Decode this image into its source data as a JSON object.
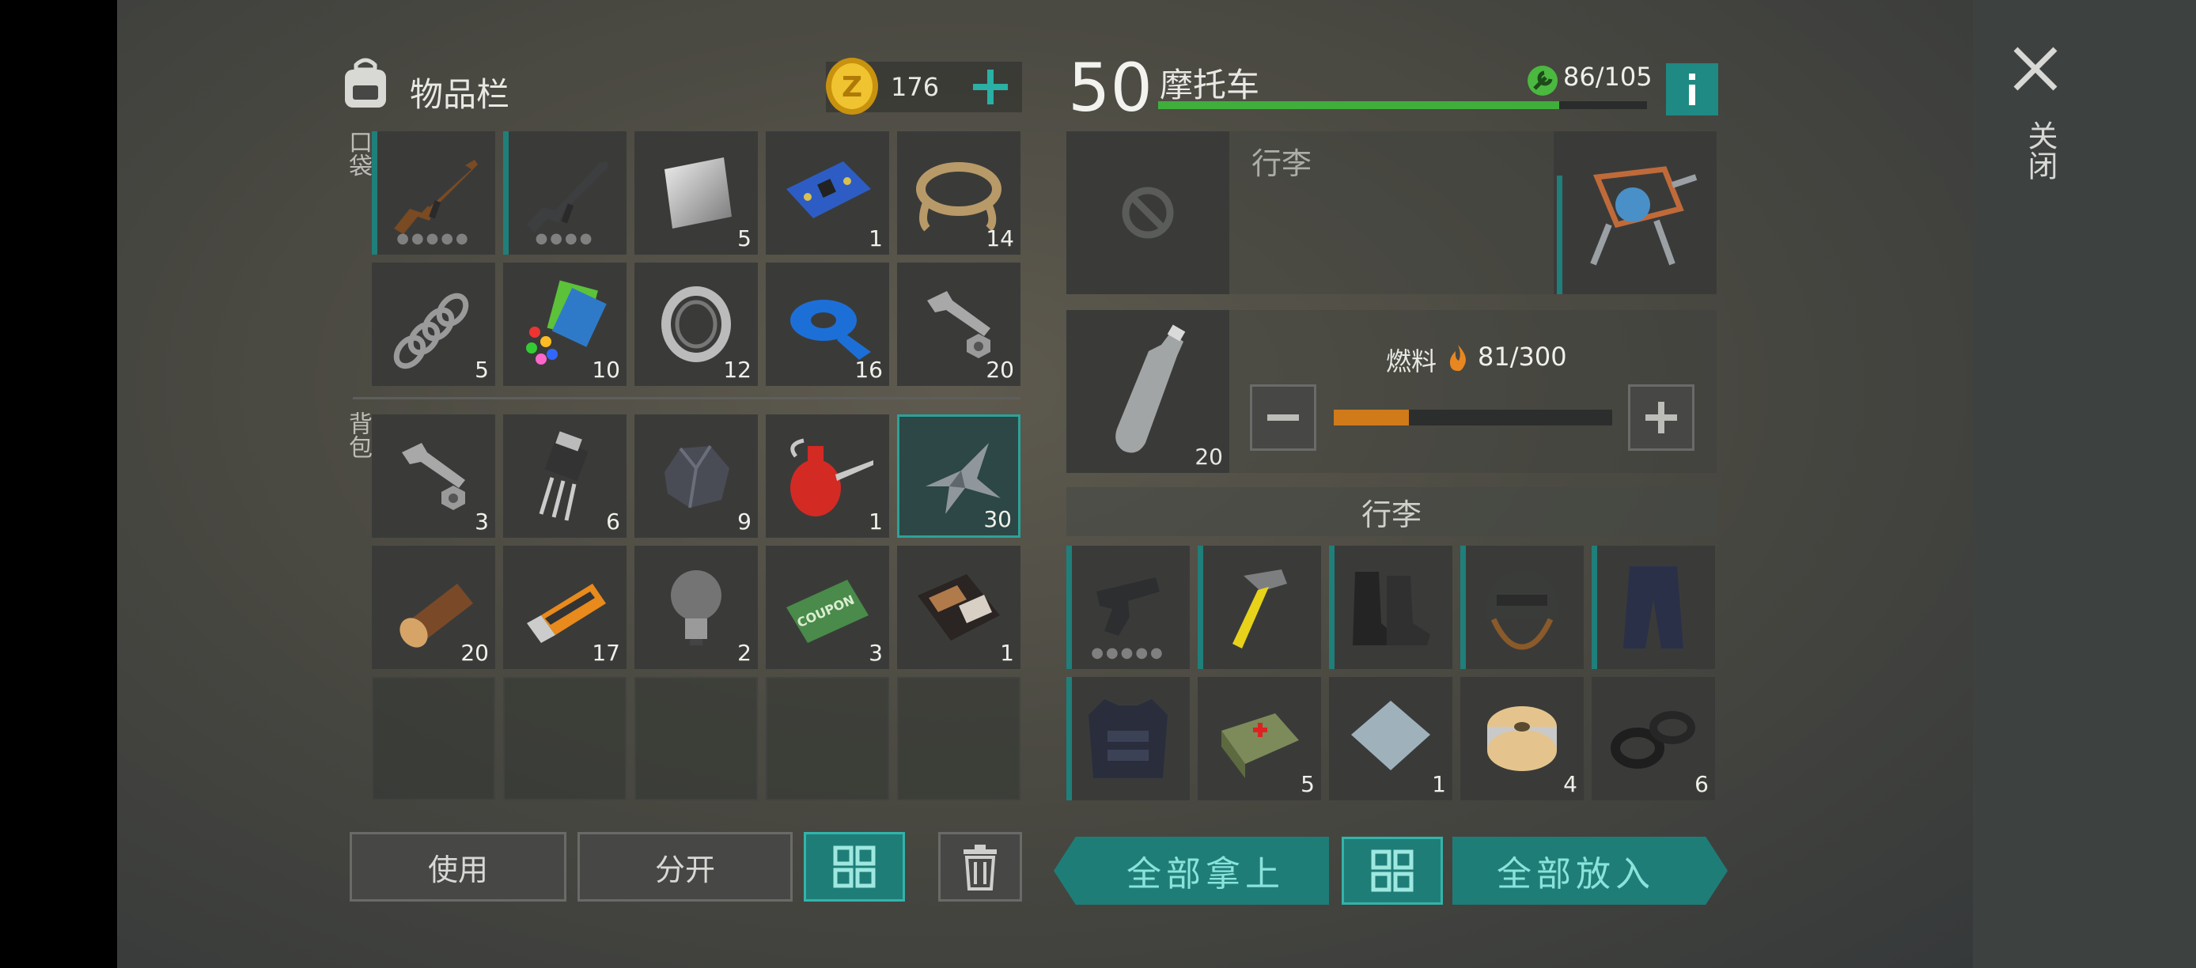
{
  "inventory": {
    "title": "物品栏",
    "coins": "176",
    "pocket_label": "口袋",
    "backpack_label": "背包",
    "pocket_items": [
      {
        "name": "ak47",
        "qty": "",
        "dots": "●●●●●"
      },
      {
        "name": "m16",
        "qty": "",
        "dots": "●●●●"
      },
      {
        "name": "metal-plate",
        "qty": "5"
      },
      {
        "name": "circuit-board",
        "qty": "1"
      },
      {
        "name": "rope",
        "qty": "14"
      },
      {
        "name": "spring",
        "qty": "5"
      },
      {
        "name": "plastic-parts",
        "qty": "10"
      },
      {
        "name": "bearing",
        "qty": "12"
      },
      {
        "name": "tape",
        "qty": "16"
      },
      {
        "name": "bolt-nut",
        "qty": "20"
      }
    ],
    "backpack_items": [
      {
        "name": "bolt-nut",
        "qty": "3"
      },
      {
        "name": "transistor",
        "qty": "6"
      },
      {
        "name": "ore",
        "qty": "9"
      },
      {
        "name": "oil-can",
        "qty": "1"
      },
      {
        "name": "scrap-metal",
        "qty": "30"
      },
      {
        "name": "wood-log",
        "qty": "20"
      },
      {
        "name": "usb-drive",
        "qty": "17"
      },
      {
        "name": "light-bulb",
        "qty": "2"
      },
      {
        "name": "ration-coupon",
        "qty": "3"
      },
      {
        "name": "wallet",
        "qty": "1"
      }
    ],
    "buttons": {
      "use": "使用",
      "split": "分开"
    }
  },
  "vehicle": {
    "level": "50",
    "name": "摩托车",
    "durability": "86/105",
    "durability_fraction": 0.82,
    "cargo_title": "行李",
    "fuel_label": "燃料",
    "fuel_value": "81/300",
    "fuel_fraction": 0.27,
    "fuel_item_qty": "20",
    "luggage_header": "行李",
    "luggage_items": [
      {
        "name": "pistol",
        "qty": "",
        "dots": "●●●●●"
      },
      {
        "name": "hammer",
        "qty": ""
      },
      {
        "name": "boots",
        "qty": ""
      },
      {
        "name": "helmet",
        "qty": ""
      },
      {
        "name": "pants",
        "qty": ""
      },
      {
        "name": "armor-vest",
        "qty": ""
      },
      {
        "name": "first-aid-bag",
        "qty": "5"
      },
      {
        "name": "steel-plate",
        "qty": "1"
      },
      {
        "name": "wire-spool",
        "qty": "4"
      },
      {
        "name": "rubber-ring",
        "qty": "6"
      }
    ],
    "take_all": "全部拿上",
    "put_all": "全部放入"
  },
  "close_label": "关闭",
  "colors": {
    "accent": "#1f7d78",
    "accent_light": "#32b4aa",
    "durability_green": "#3fae3a",
    "fuel_orange": "#d07a1a"
  }
}
